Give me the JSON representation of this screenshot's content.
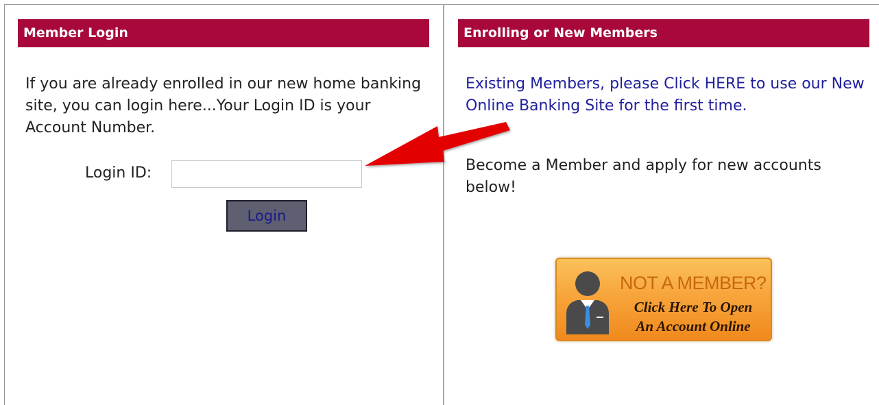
{
  "left_panel": {
    "header": "Member Login",
    "intro": "If you are already enrolled in our new home banking site, you can login here...Your Login ID is your Account Number.",
    "login_label": "Login ID:",
    "login_input_value": "",
    "login_button": "Login"
  },
  "right_panel": {
    "header": "Enrolling or New Members",
    "existing_link": "Existing Members, please Click HERE to use our New Online Banking Site for the first time.",
    "become_text": "Become a Member and apply for new accounts below!",
    "banner": {
      "headline": "NOT A MEMBER?",
      "sub_line1": "Click Here To Open",
      "sub_line2": "An Account Online"
    }
  },
  "colors": {
    "header_bg": "#a8093a",
    "link": "#1f1f9c",
    "arrow": "#e30000",
    "banner_orange": "#f7a53c"
  },
  "icons": {
    "arrow": "red-arrow-icon",
    "person": "person-icon"
  }
}
